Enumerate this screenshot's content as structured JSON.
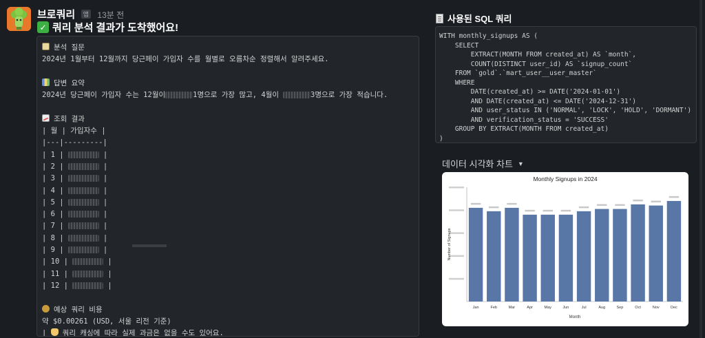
{
  "message": {
    "sender": "브로쿼리",
    "app_badge": "앱",
    "timestamp": "13분 전",
    "headline": "쿼리 분석 결과가 도착했어요!"
  },
  "answer": {
    "question_label": "분석 질문",
    "question_text": "2024년 1월부터 12월까지 당근페이 가입자 수를 월별로 오름차순 정렬해서 알려주세요.",
    "summary_label": "답변 요약",
    "summary_prefix": "2024년 당근페이 가입자 수는 12월이",
    "summary_mid": "1명으로 가장 많고, 4월이",
    "summary_suffix": "3명으로 가장 적습니다.",
    "result_label": "조회 결과",
    "table_header": "| 월 | 가입자수 |",
    "table_sep": "|---|---------|",
    "rows": [
      "| 1 |",
      "| 2 |",
      "| 3 |",
      "| 4 |",
      "| 5 |",
      "| 6 |",
      "| 7 |",
      "| 8 |",
      "| 9 |",
      "| 10 |",
      "| 11 |",
      "| 12 |"
    ],
    "cost_label": "예상 쿼리 비용",
    "cost_text": "약 $0.00261 (USD, 서울 리전 기준)",
    "cost_note": "쿼리 캐싱에 따라 실제 과금은 없을 수도 있어요."
  },
  "sql": {
    "title": "사용된 SQL 쿼리",
    "lines": [
      "WITH monthly_signups AS (",
      "    SELECT",
      "        EXTRACT(MONTH FROM created_at) AS `month`,",
      "        COUNT(DISTINCT user_id) AS `signup_count`",
      "    FROM `gold`.`mart_user__user_master`",
      "    WHERE",
      "        DATE(created_at) >= DATE('2024-01-01')",
      "        AND DATE(created_at) <= DATE('2024-12-31')",
      "        AND user_status IN ('NORMAL', 'LOCK', 'HOLD', 'DORMANT')",
      "        AND verification_status = 'SUCCESS'",
      "    GROUP BY EXTRACT(MONTH FROM created_at)",
      ")"
    ]
  },
  "viz": {
    "title": "데이터 시각화 차트",
    "caret": "▼"
  },
  "colors": {
    "bar": "#5876a6",
    "background": "#1a1d21",
    "code_bg": "#222529"
  },
  "chart_data": {
    "type": "bar",
    "title": "Monthly Signups in 2024",
    "xlabel": "Month",
    "ylabel": "Number of Signups",
    "categories": [
      "Jan",
      "Feb",
      "Mar",
      "Apr",
      "May",
      "Jun",
      "Jul",
      "Aug",
      "Sep",
      "Oct",
      "Nov",
      "Dec"
    ],
    "values": [
      82,
      79,
      82,
      76,
      76,
      76,
      79,
      81,
      81,
      85,
      84,
      88
    ],
    "ylim": [
      0,
      100
    ],
    "grid": false,
    "legend": "none"
  }
}
